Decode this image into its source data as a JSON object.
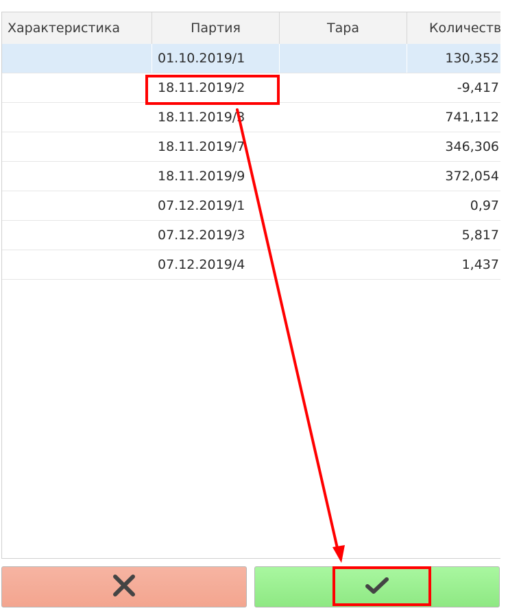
{
  "table": {
    "columns": {
      "characteristic": "Характеристика",
      "party": "Партия",
      "tara": "Тара",
      "quantity": "Количество"
    },
    "rows": [
      {
        "characteristic": "",
        "party": "01.10.2019/1",
        "tara": "",
        "quantity": "130,352",
        "selected": true
      },
      {
        "characteristic": "",
        "party": "18.11.2019/2",
        "tara": "",
        "quantity": "-9,417"
      },
      {
        "characteristic": "",
        "party": "18.11.2019/3",
        "tara": "",
        "quantity": "741,112"
      },
      {
        "characteristic": "",
        "party": "18.11.2019/7",
        "tara": "",
        "quantity": "346,306"
      },
      {
        "characteristic": "",
        "party": "18.11.2019/9",
        "tara": "",
        "quantity": "372,054"
      },
      {
        "characteristic": "",
        "party": "07.12.2019/1",
        "tara": "",
        "quantity": "0,97"
      },
      {
        "characteristic": "",
        "party": "07.12.2019/3",
        "tara": "",
        "quantity": "5,817"
      },
      {
        "characteristic": "",
        "party": "07.12.2019/4",
        "tara": "",
        "quantity": "1,437"
      }
    ]
  },
  "buttons": {
    "cancel_icon": "close-icon",
    "ok_icon": "checkmark-icon"
  },
  "annotation": {
    "color": "#ff0000",
    "highlighted_row": "18.11.2019/2"
  },
  "colors": {
    "selected_row": "#dcebf9",
    "cancel_button": "#f3a58f",
    "ok_button": "#8ee883"
  }
}
